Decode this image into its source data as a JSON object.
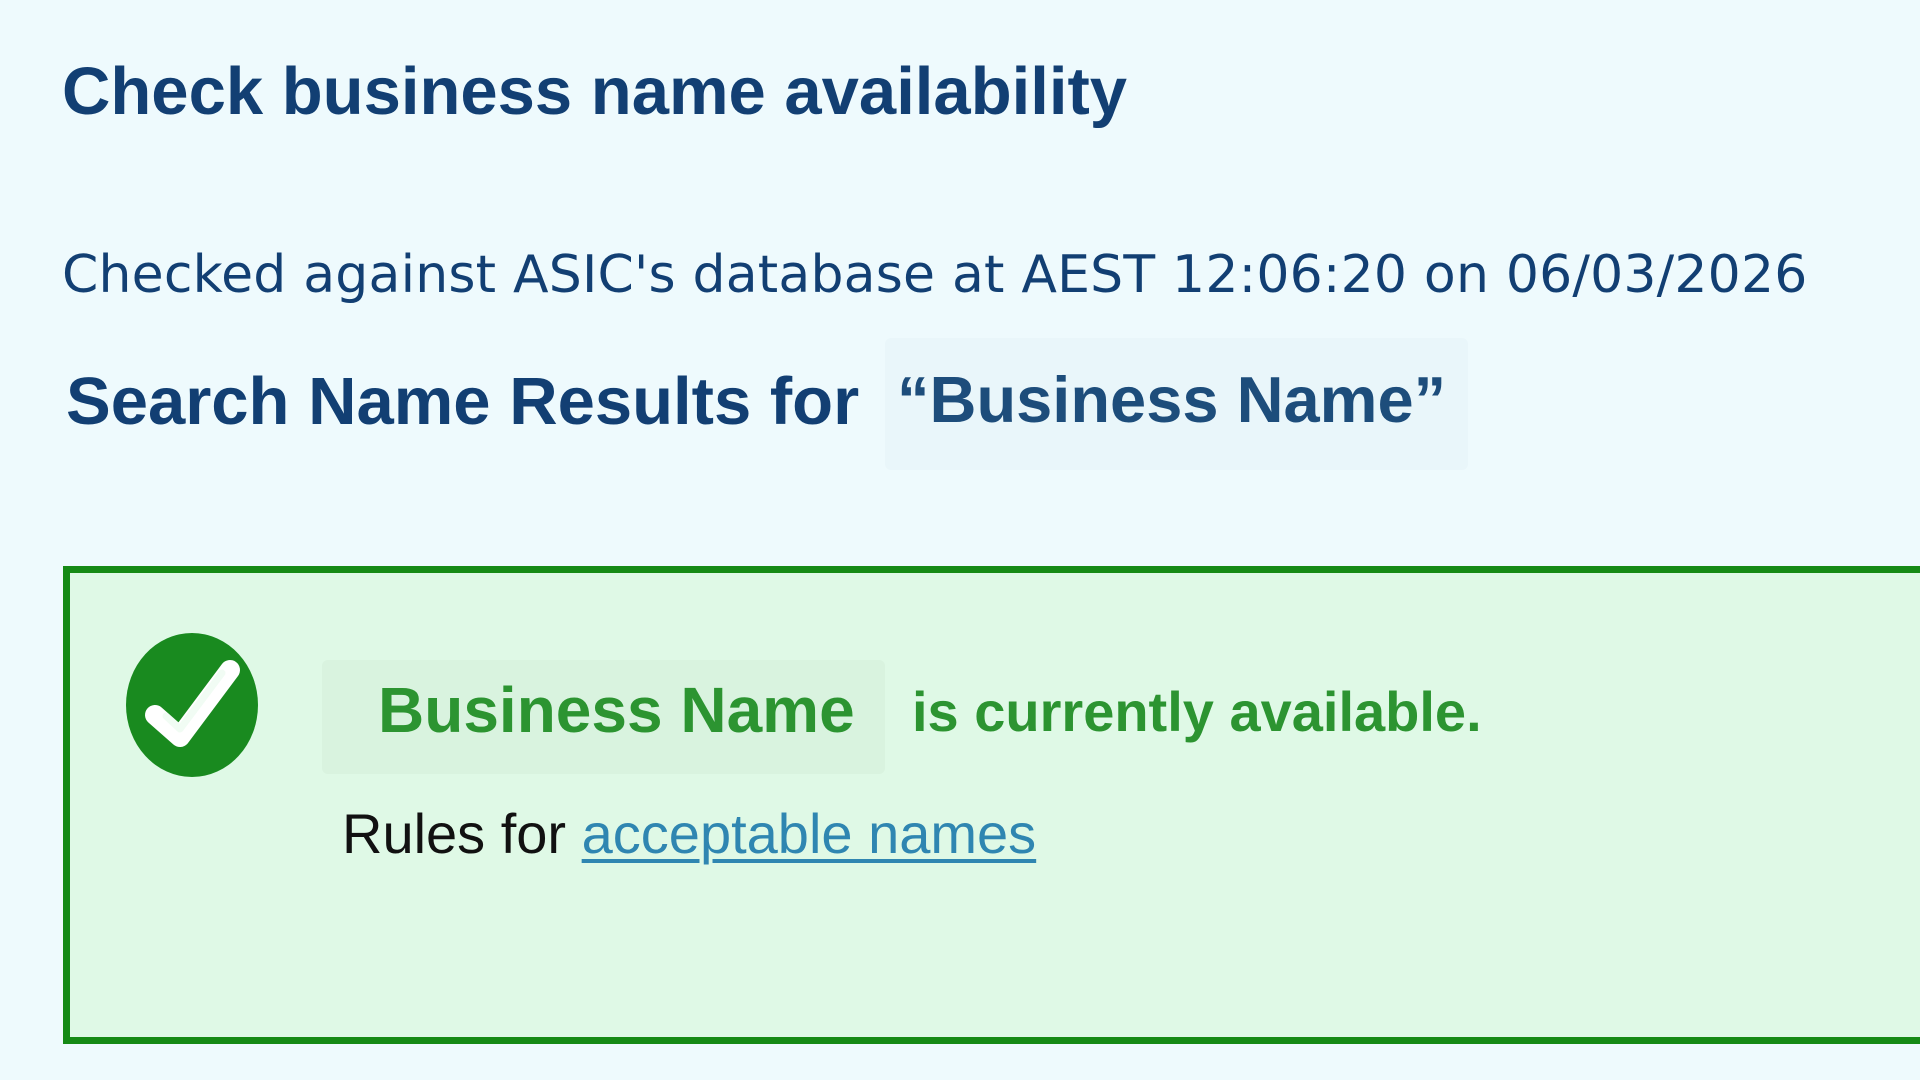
{
  "header": {
    "title": "Check business name availability"
  },
  "search_info": {
    "checked_text": "Checked against ASIC's database at AEST 12:06:20 on 06/03/2026",
    "results_prefix": "Search Name Results for",
    "query_text": "“Business Name”"
  },
  "result": {
    "status": "available",
    "icon": "check-circle-icon",
    "name": "Business Name",
    "message": "is currently available.",
    "rules_prefix": "Rules for",
    "rules_link_label": "acceptable names"
  },
  "colors": {
    "background": "#eefafd",
    "title": "#123f73",
    "success": "#158a15",
    "success_text": "#2c9431",
    "link": "#2f86b1",
    "panel_background": "#dff9e6"
  }
}
